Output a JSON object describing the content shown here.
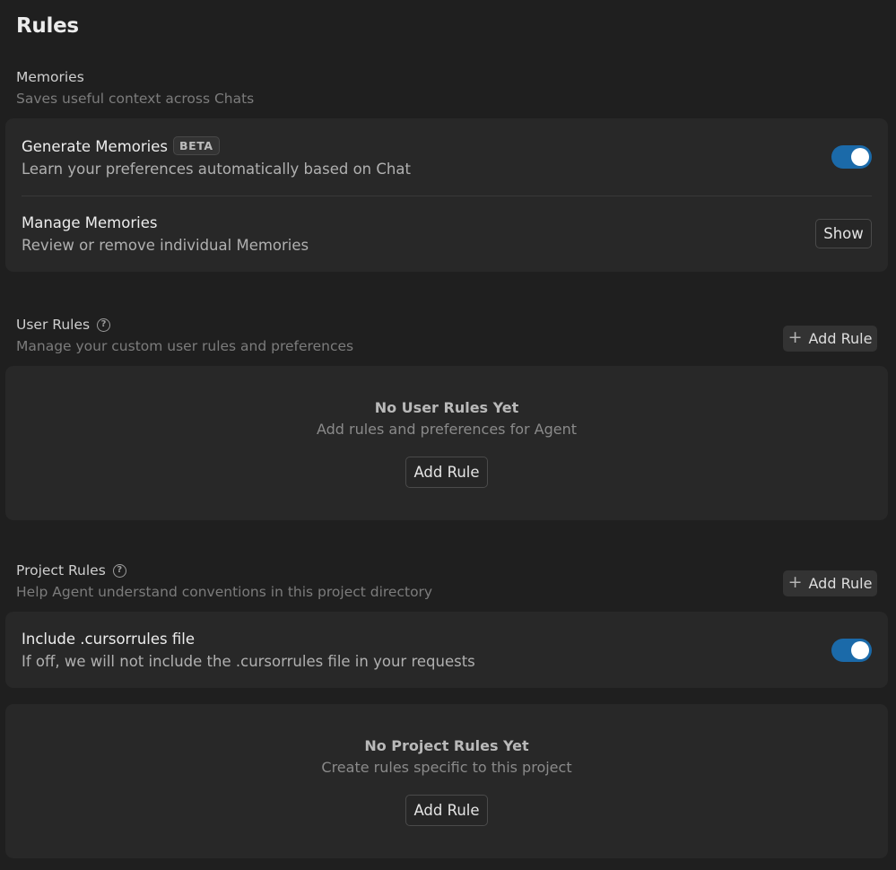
{
  "page": {
    "title": "Rules"
  },
  "memories": {
    "title": "Memories",
    "subtitle": "Saves useful context across Chats",
    "generate": {
      "title": "Generate Memories",
      "badge": "BETA",
      "subtitle": "Learn your preferences automatically based on Chat",
      "enabled": true
    },
    "manage": {
      "title": "Manage Memories",
      "subtitle": "Review or remove individual Memories",
      "button_label": "Show"
    }
  },
  "user_rules": {
    "title": "User Rules",
    "subtitle": "Manage your custom user rules and preferences",
    "add_button_label": "Add Rule",
    "empty_title": "No User Rules Yet",
    "empty_subtitle": "Add rules and preferences for Agent",
    "empty_button_label": "Add Rule"
  },
  "project_rules": {
    "title": "Project Rules",
    "subtitle": "Help Agent understand conventions in this project directory",
    "add_button_label": "Add Rule",
    "cursorrules": {
      "title": "Include .cursorrules file",
      "subtitle": "If off, we will not include the .cursorrules file in your requests",
      "enabled": true
    },
    "empty_title": "No Project Rules Yet",
    "empty_subtitle": "Create rules specific to this project",
    "empty_button_label": "Add Rule"
  },
  "icons": {
    "help": "help-circle-icon",
    "plus": "plus-icon"
  },
  "colors": {
    "background": "#1f1f1f",
    "card": "#282828",
    "toggle_on": "#1b6aa9"
  }
}
